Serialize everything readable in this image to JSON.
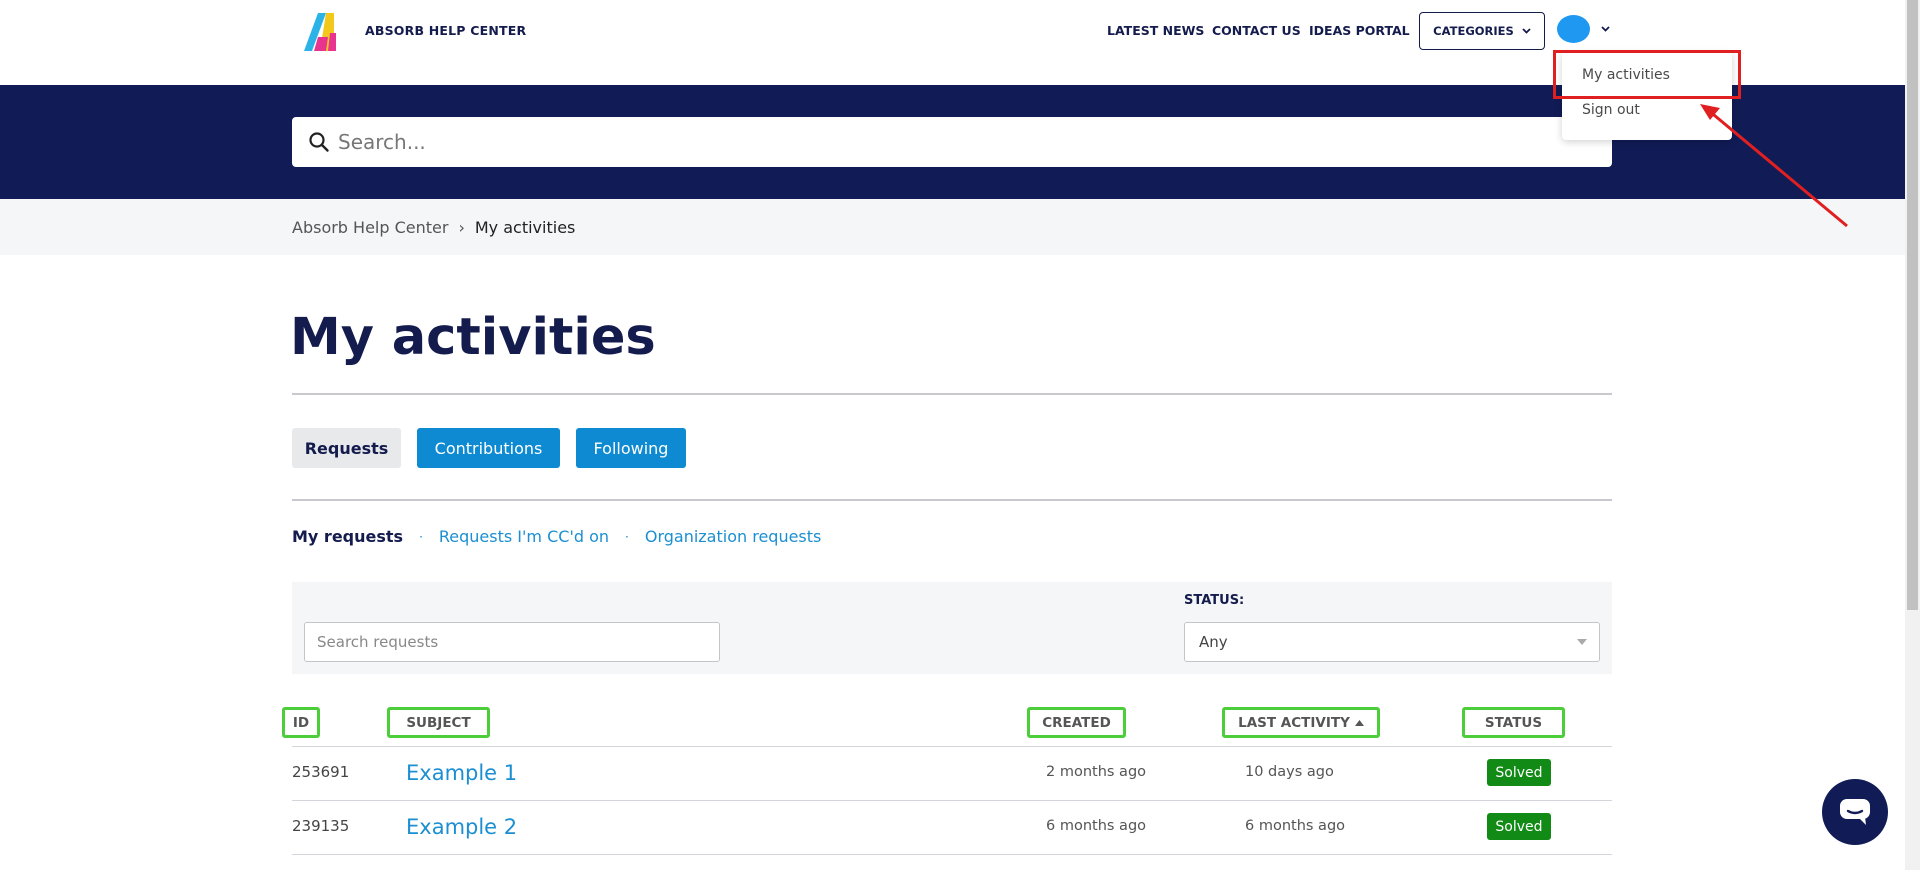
{
  "header": {
    "brand": "ABSORB HELP CENTER",
    "nav": [
      "LATEST NEWS",
      "CONTACT US",
      "IDEAS PORTAL"
    ],
    "categories_label": "CATEGORIES",
    "logo_icon": "absorb-logo-icon",
    "avatar_color": "#1e98f0"
  },
  "user_menu": {
    "items": [
      "My activities",
      "Sign out"
    ],
    "highlight_color": "#e02020"
  },
  "search": {
    "placeholder": "Search..."
  },
  "breadcrumb": {
    "items": [
      "Absorb Help Center",
      "My activities"
    ],
    "separator": "›"
  },
  "page": {
    "title": "My activities"
  },
  "tabs": {
    "items": [
      "Requests",
      "Contributions",
      "Following"
    ],
    "active": "Requests"
  },
  "subtabs": {
    "items": [
      "My requests",
      "Requests I'm CC'd on",
      "Organization requests"
    ],
    "active": "My requests",
    "separator": "·"
  },
  "filter": {
    "search_placeholder": "Search requests",
    "status_label": "STATUS:",
    "status_value": "Any"
  },
  "table": {
    "columns": [
      "ID",
      "SUBJECT",
      "CREATED",
      "LAST ACTIVITY",
      "STATUS"
    ],
    "sorted_column": "LAST ACTIVITY",
    "header_highlight_color": "#4ccd3a",
    "rows": [
      {
        "id": "253691",
        "subject": "Example 1",
        "created": "2 months ago",
        "last_activity": "10 days ago",
        "status": "Solved"
      },
      {
        "id": "239135",
        "subject": "Example 2",
        "created": "6 months ago",
        "last_activity": "6 months ago",
        "status": "Solved"
      }
    ],
    "status_color": "#118a16"
  },
  "chat": {
    "icon": "chat-bubble-icon"
  },
  "colors": {
    "navy": "#111b55",
    "accent_blue": "#0d8ad1"
  }
}
